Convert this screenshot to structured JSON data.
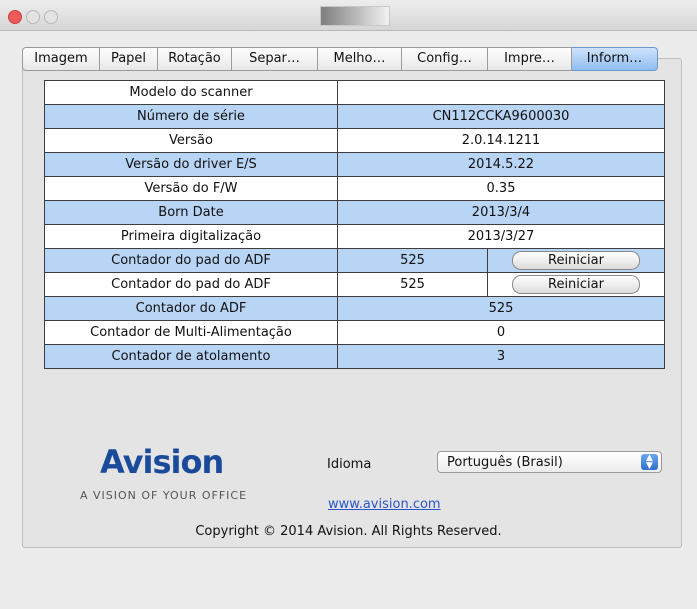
{
  "tabs": [
    {
      "label": "Imagem",
      "active": false
    },
    {
      "label": "Papel",
      "active": false
    },
    {
      "label": "Rotação",
      "active": false
    },
    {
      "label": "Separ…",
      "active": false
    },
    {
      "label": "Melho…",
      "active": false
    },
    {
      "label": "Config…",
      "active": false
    },
    {
      "label": "Impre…",
      "active": false
    },
    {
      "label": "Inform…",
      "active": true
    }
  ],
  "info_rows": [
    {
      "label": "Modelo do scanner",
      "value": ""
    },
    {
      "label": "Número de série",
      "value": "CN112CCKA9600030"
    },
    {
      "label": "Versão",
      "value": "2.0.14.1211"
    },
    {
      "label": "Versão do driver E/S",
      "value": "2014.5.22"
    },
    {
      "label": "Versão do F/W",
      "value": "0.35"
    },
    {
      "label": "Born Date",
      "value": "2013/3/4"
    },
    {
      "label": "Primeira digitalização",
      "value": "2013/3/27"
    },
    {
      "label": "Contador do pad do ADF",
      "value": "525",
      "button": "Reiniciar"
    },
    {
      "label": "Contador do pad do ADF",
      "value": "525",
      "button": "Reiniciar"
    },
    {
      "label": "Contador do ADF",
      "value": "525"
    },
    {
      "label": "Contador de Multi-Alimentação",
      "value": "0"
    },
    {
      "label": "Contador de atolamento",
      "value": "3"
    }
  ],
  "brand": {
    "logo": "Avision",
    "tagline": "A VISION OF YOUR OFFICE"
  },
  "language": {
    "label": "Idioma",
    "selected": "Português (Brasil)"
  },
  "website": "www.avision.com",
  "copyright": "Copyright © 2014 Avision. All Rights Reserved.",
  "colors": {
    "row_blue": "#b9d5f5",
    "active_tab": "#8fbdf0",
    "brand_blue": "#1a4a9a",
    "link": "#2b56c8"
  },
  "icons": {
    "close": "close-icon",
    "minimize": "minimize-icon",
    "maximize": "maximize-icon",
    "window": "window-title-icon",
    "select_arrows": "up-down-chevron-icon"
  }
}
